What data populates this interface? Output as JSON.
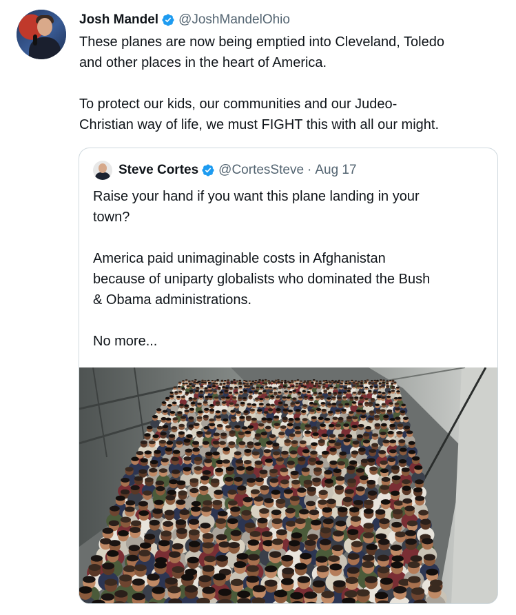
{
  "tweet": {
    "author_name": "Josh Mandel",
    "author_handle": "@JoshMandelOhio",
    "verified_icon": "verified-badge-icon",
    "lines": [
      "These planes are now being emptied into Cleveland, Toledo",
      "and other places in the heart of America.",
      "",
      "To protect our kids, our communities and our Judeo-",
      "Christian way of life, we must FIGHT this with all our might."
    ]
  },
  "quoted_tweet": {
    "author_name": "Steve Cortes",
    "author_handle": "@CortesSteve",
    "separator": "·",
    "date": "Aug 17",
    "verified_icon": "verified-badge-icon",
    "lines": [
      "Raise your hand if you want this plane landing in your",
      "town?",
      "",
      "America paid unimaginable costs in Afghanistan",
      "because of uniparty globalists who dominated the Bush",
      "& Obama administrations.",
      "",
      "No more..."
    ],
    "image": "crowded-plane-cabin-photo"
  },
  "colors": {
    "text": "#0f1419",
    "secondary": "#536471",
    "verified": "#1d9bf0",
    "border": "#cfd9de"
  }
}
